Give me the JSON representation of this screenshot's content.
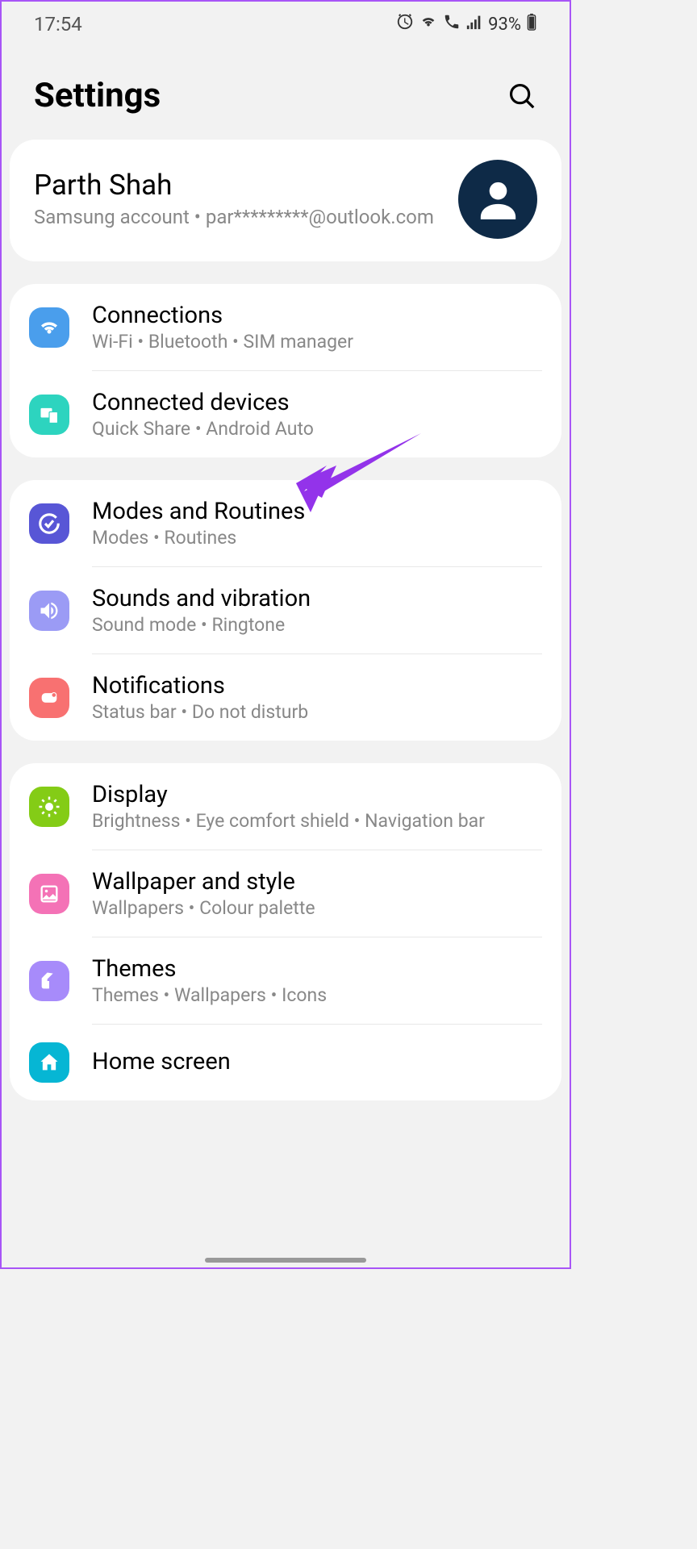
{
  "status_bar": {
    "time": "17:54",
    "battery_percent": "93%"
  },
  "header": {
    "title": "Settings"
  },
  "account": {
    "name": "Parth Shah",
    "subtitle": "Samsung account  •  par*********@outlook.com"
  },
  "groups": [
    {
      "items": [
        {
          "icon_color": "#4a9eec",
          "icon_name": "wifi-icon",
          "title": "Connections",
          "subtitle": "Wi-Fi  •  Bluetooth  •  SIM manager"
        },
        {
          "icon_color": "#2dd4bf",
          "icon_name": "devices-icon",
          "title": "Connected devices",
          "subtitle": "Quick Share  •  Android Auto"
        }
      ]
    },
    {
      "items": [
        {
          "icon_color": "#5856d6",
          "icon_name": "routines-icon",
          "title": "Modes and Routines",
          "subtitle": "Modes  •  Routines"
        },
        {
          "icon_color": "#9b9bf5",
          "icon_name": "sound-icon",
          "title": "Sounds and vibration",
          "subtitle": "Sound mode  •  Ringtone"
        },
        {
          "icon_color": "#f87171",
          "icon_name": "notifications-icon",
          "title": "Notifications",
          "subtitle": "Status bar  •  Do not disturb"
        }
      ]
    },
    {
      "items": [
        {
          "icon_color": "#84cc16",
          "icon_name": "display-icon",
          "title": "Display",
          "subtitle": "Brightness  •  Eye comfort shield  •  Navigation bar"
        },
        {
          "icon_color": "#f472b6",
          "icon_name": "wallpaper-icon",
          "title": "Wallpaper and style",
          "subtitle": "Wallpapers  •  Colour palette"
        },
        {
          "icon_color": "#a78bfa",
          "icon_name": "themes-icon",
          "title": "Themes",
          "subtitle": "Themes  •  Wallpapers  •  Icons"
        },
        {
          "icon_color": "#06b6d4",
          "icon_name": "home-icon",
          "title": "Home screen",
          "subtitle": ""
        }
      ]
    }
  ]
}
